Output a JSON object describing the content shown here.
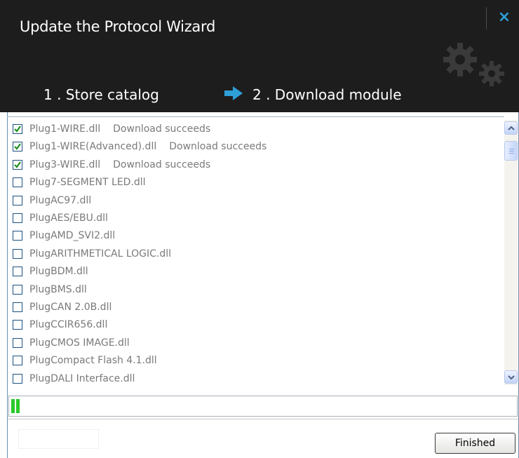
{
  "window": {
    "title": "Update the Protocol Wizard",
    "close_label": "×"
  },
  "steps": {
    "step1": "1 . Store catalog",
    "step2": "2 . Download module"
  },
  "list": {
    "items": [
      {
        "name": "Plug1-WIRE.dll",
        "status": "Download succeeds",
        "checked": true
      },
      {
        "name": "Plug1-WIRE(Advanced).dll",
        "status": "Download succeeds",
        "checked": true
      },
      {
        "name": "Plug3-WIRE.dll",
        "status": "Download succeeds",
        "checked": true
      },
      {
        "name": "Plug7-SEGMENT LED.dll",
        "status": "",
        "checked": false
      },
      {
        "name": "PlugAC97.dll",
        "status": "",
        "checked": false
      },
      {
        "name": "PlugAES/EBU.dll",
        "status": "",
        "checked": false
      },
      {
        "name": "PlugAMD_SVI2.dll",
        "status": "",
        "checked": false
      },
      {
        "name": "PlugARITHMETICAL LOGIC.dll",
        "status": "",
        "checked": false
      },
      {
        "name": "PlugBDM.dll",
        "status": "",
        "checked": false
      },
      {
        "name": "PlugBMS.dll",
        "status": "",
        "checked": false
      },
      {
        "name": "PlugCAN 2.0B.dll",
        "status": "",
        "checked": false
      },
      {
        "name": "PlugCCIR656.dll",
        "status": "",
        "checked": false
      },
      {
        "name": "PlugCMOS IMAGE.dll",
        "status": "",
        "checked": false
      },
      {
        "name": "PlugCompact Flash 4.1.dll",
        "status": "",
        "checked": false
      },
      {
        "name": "PlugDALI Interface.dll",
        "status": "",
        "checked": false
      }
    ]
  },
  "progress": {
    "filled_segments": 2
  },
  "buttons": {
    "finished": "Finished"
  },
  "colors": {
    "header_bg": "#1d1d1d",
    "accent_blue": "#2f9fd8",
    "progress_green": "#2aca2a",
    "check_green": "#1f8f1f",
    "item_text": "#7a7a7a"
  },
  "icons": {
    "close": "close-icon",
    "step_arrow": "arrow-right-icon",
    "gears": "gears-icon",
    "scroll_up": "chevron-up-icon",
    "scroll_down": "chevron-down-icon"
  }
}
